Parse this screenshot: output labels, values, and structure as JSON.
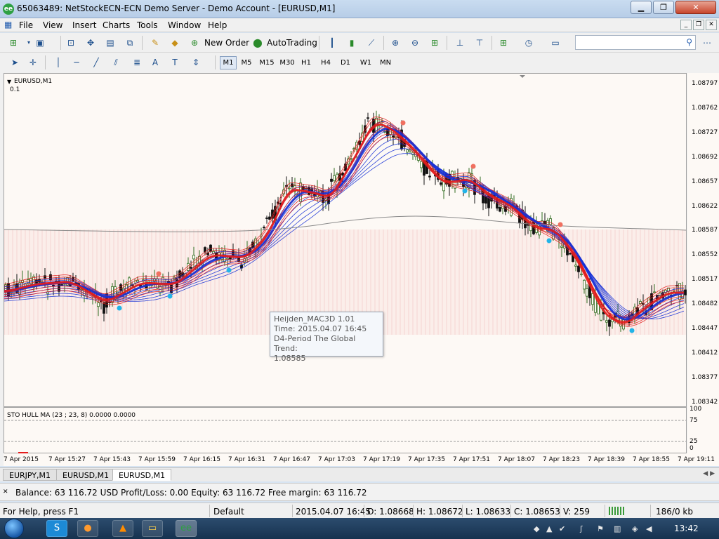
{
  "window": {
    "title": "65063489: NetStockECN-ECN Demo Server - Demo Account - [EURUSD,M1]",
    "app_icon_text": "ee"
  },
  "menu": [
    "File",
    "View",
    "Insert",
    "Charts",
    "Tools",
    "Window",
    "Help"
  ],
  "toolbar": {
    "new_order": "New Order",
    "autotrading": "AutoTrading",
    "search_placeholder": ""
  },
  "timeframes": [
    "M1",
    "M5",
    "M15",
    "M30",
    "H1",
    "H4",
    "D1",
    "W1",
    "MN"
  ],
  "active_timeframe": "M1",
  "chart": {
    "symbol": "EURUSD,M1",
    "sub_label": "0.1",
    "indicator_label": "STO HULL MA (23 ; 23, 8) 0.0000 0.0000",
    "price_ticks": [
      "1.08797",
      "1.08762",
      "1.08727",
      "1.08692",
      "1.08657",
      "1.08622",
      "1.08587",
      "1.08552",
      "1.08517",
      "1.08482",
      "1.08447",
      "1.08412",
      "1.08377",
      "1.08342"
    ],
    "sub_ticks": [
      "100",
      "75",
      "25",
      "0"
    ],
    "time_ticks": [
      "7 Apr 2015",
      "7 Apr 15:27",
      "7 Apr 15:43",
      "7 Apr 15:59",
      "7 Apr 16:15",
      "7 Apr 16:31",
      "7 Apr 16:47",
      "7 Apr 17:03",
      "7 Apr 17:19",
      "7 Apr 17:35",
      "7 Apr 17:51",
      "7 Apr 18:07",
      "7 Apr 18:23",
      "7 Apr 18:39",
      "7 Apr 18:55",
      "7 Apr 19:11"
    ],
    "colors": {
      "bull": "#2f6b1e",
      "bear": "#111111",
      "fast_ribbon": "#e31c1c",
      "slow_ribbon": "#1530d6",
      "trend": "#8a8a8a",
      "dot_up": "#22b4e8",
      "dot_down": "#f07060"
    }
  },
  "tooltip": {
    "line1": "Heijden_MAC3D 1.01",
    "line2": "Time: 2015.04.07 16:45",
    "line3": "D4-Period The Global Trend:",
    "line4": "1.08585"
  },
  "tabs": [
    "EURJPY,M1",
    "EURUSD,M1",
    "EURUSD,M1"
  ],
  "active_tab": 2,
  "terminal": {
    "text": "Balance: 63 116.72 USD  Profit/Loss: 0.00  Equity: 63 116.72  Free margin: 63 116.72"
  },
  "status": {
    "help": "For Help, press F1",
    "profile": "Default",
    "datetime": "2015.04.07 16:45",
    "open": "O: 1.08668",
    "high": "H: 1.08672",
    "low": "L: 1.08633",
    "close": "C: 1.08653",
    "volume": "V: 259",
    "traffic": "186/0 kb"
  },
  "taskbar": {
    "clock": "13:42"
  }
}
